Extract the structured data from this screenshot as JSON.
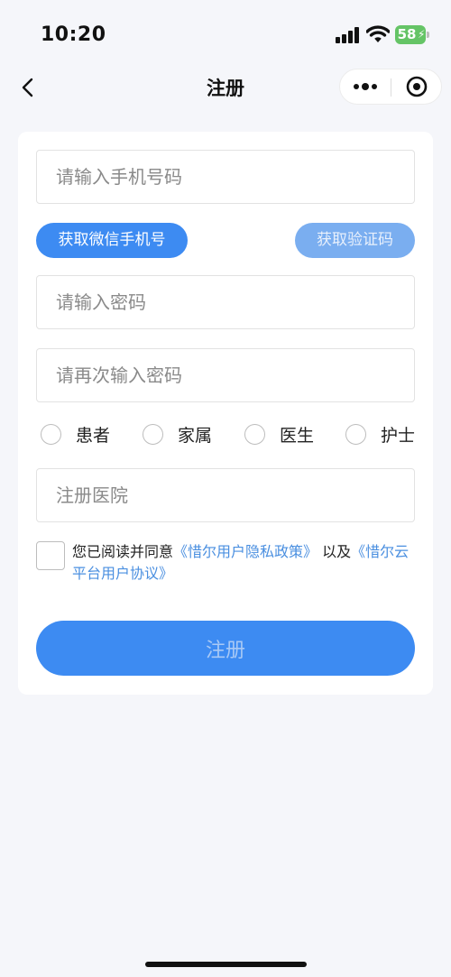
{
  "status_bar": {
    "time": "10:20",
    "battery": "58"
  },
  "nav": {
    "title": "注册"
  },
  "form": {
    "phone_placeholder": "请输入手机号码",
    "wechat_phone_button": "获取微信手机号",
    "get_code_button": "获取验证码",
    "password_placeholder": "请输入密码",
    "confirm_password_placeholder": "请再次输入密码",
    "roles": [
      "患者",
      "家属",
      "医生",
      "护士"
    ],
    "hospital_placeholder": "注册医院",
    "agreement": {
      "prefix": "您已阅读并同意",
      "privacy_link": "《惜尔用户隐私政策》",
      "middle": " 以及",
      "terms_link": "《惜尔云平台用户协议》"
    },
    "submit_button": "注册"
  },
  "colors": {
    "primary": "#3d8bf2",
    "link": "#4a8fe0",
    "background": "#f5f6fa",
    "battery": "#65c466"
  }
}
